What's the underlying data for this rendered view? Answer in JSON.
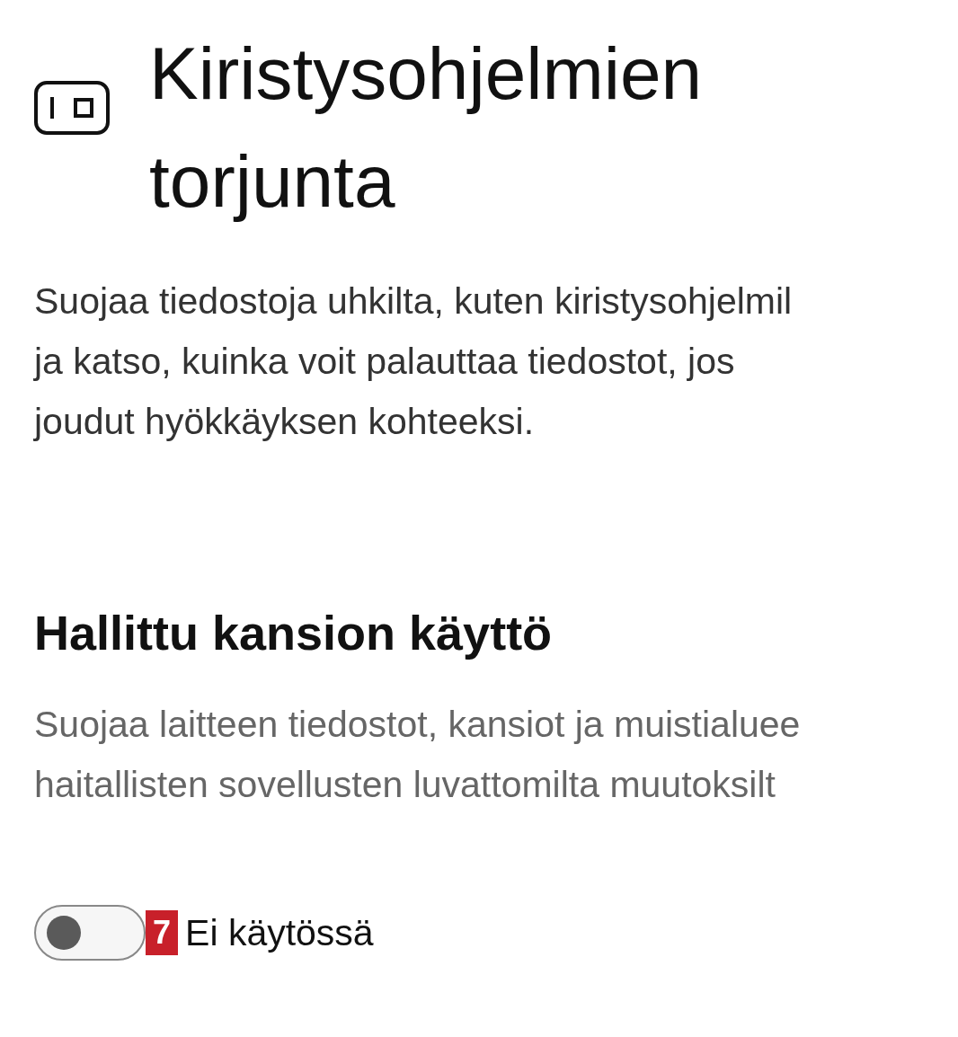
{
  "page": {
    "title_lines": [
      "Kiristysohjelmien",
      "torjunta"
    ],
    "description_lines": [
      "Suojaa tiedostoja uhkilta, kuten kiristysohjelmil",
      "ja katso, kuinka voit palauttaa tiedostot, jos",
      "joudut hyökkäyksen kohteeksi."
    ]
  },
  "section": {
    "heading": "Hallittu kansion käyttö",
    "description_lines": [
      "Suojaa laitteen tiedostot, kansiot ja muistialuee",
      "haitallisten sovellusten luvattomilta muutoksilt"
    ],
    "toggle": {
      "on": false,
      "label": "Ei käytössä"
    },
    "annotation_badge": "7"
  }
}
